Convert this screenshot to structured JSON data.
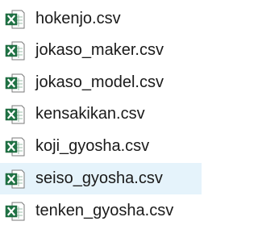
{
  "file_list": {
    "icon": "excel-csv-file-icon",
    "icon_colors": {
      "excel_green": "#1f7244",
      "excel_green_dark": "#185c37",
      "page": "#ffffff",
      "page_border": "#7a7a7a",
      "grid": "#9bbfa8"
    },
    "hover_color": "#e5f3fb",
    "files": [
      {
        "name": "hokenjo.csv"
      },
      {
        "name": "jokaso_maker.csv"
      },
      {
        "name": "jokaso_model.csv"
      },
      {
        "name": "kensakikan.csv"
      },
      {
        "name": "koji_gyosha.csv"
      },
      {
        "name": "seiso_gyosha.csv",
        "hovered": true
      },
      {
        "name": "tenken_gyosha.csv"
      }
    ]
  }
}
